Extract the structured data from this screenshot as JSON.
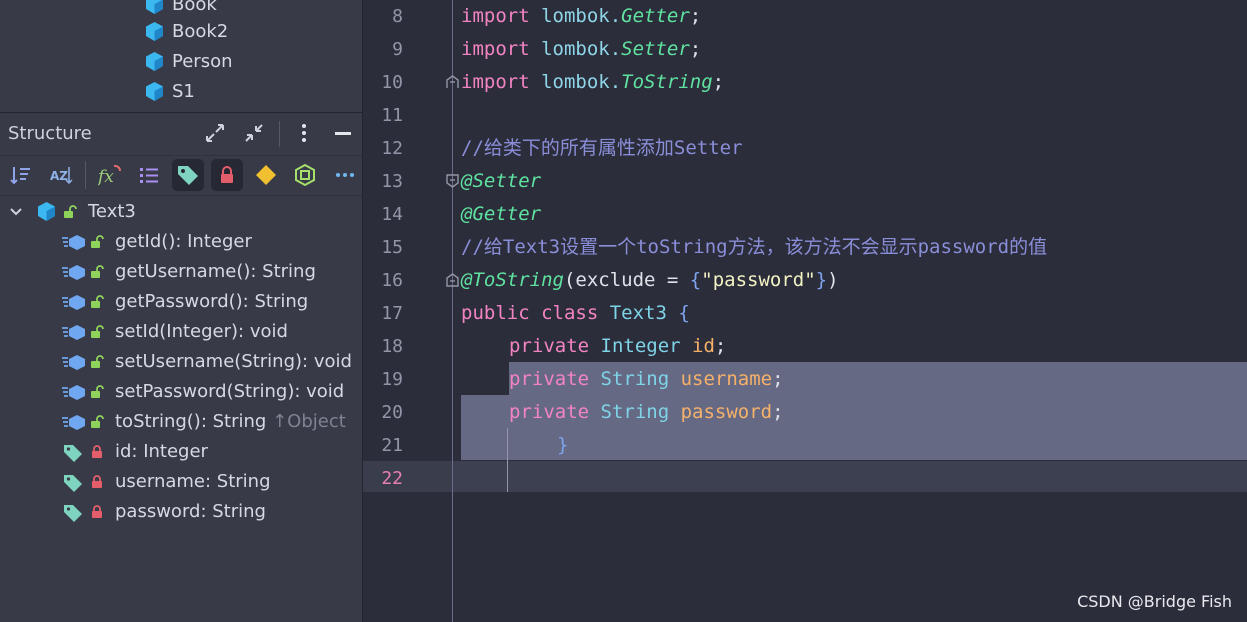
{
  "project": {
    "items": [
      {
        "label": "Book"
      },
      {
        "label": "Book2"
      },
      {
        "label": "Person"
      },
      {
        "label": "S1"
      }
    ]
  },
  "structure": {
    "title": "Structure",
    "root": "Text3",
    "members": [
      {
        "label": "getId(): Integer",
        "kind": "method",
        "access": "public"
      },
      {
        "label": "getUsername(): String",
        "kind": "method",
        "access": "public"
      },
      {
        "label": "getPassword(): String",
        "kind": "method",
        "access": "public"
      },
      {
        "label": "setId(Integer): void",
        "kind": "method",
        "access": "public"
      },
      {
        "label": "setUsername(String): void",
        "kind": "method",
        "access": "public"
      },
      {
        "label": "setPassword(String): void",
        "kind": "method",
        "access": "public"
      },
      {
        "label": "toString(): String",
        "suffix": "↑Object",
        "kind": "method",
        "access": "public"
      },
      {
        "label": "id: Integer",
        "kind": "field",
        "access": "private"
      },
      {
        "label": "username: String",
        "kind": "field",
        "access": "private"
      },
      {
        "label": "password: String",
        "kind": "field",
        "access": "private"
      }
    ]
  },
  "editor": {
    "line_numbers": [
      "8",
      "9",
      "10",
      "11",
      "12",
      "13",
      "14",
      "15",
      "16",
      "17",
      "18",
      "19",
      "20",
      "21",
      "22"
    ],
    "lines": {
      "l8": {
        "kw": "import",
        "pkg": " lombok.",
        "cls": "Getter",
        "end": ";"
      },
      "l9": {
        "kw": "import",
        "pkg": " lombok.",
        "cls": "Setter",
        "end": ";"
      },
      "l10": {
        "kw": "import",
        "pkg": " lombok.",
        "cls": "ToString",
        "end": ";"
      },
      "l12": {
        "comment": "//给类下的所有属性添加Setter"
      },
      "l13": {
        "ann": "@Setter"
      },
      "l14": {
        "ann": "@Getter"
      },
      "l15": {
        "comment": "//给Text3设置一个toString方法，该方法不会显示password的值"
      },
      "l16": {
        "ann": "@ToString",
        "p1": "(exclude = ",
        "b1": "{",
        "str": "\"password\"",
        "b2": "}",
        "p2": ")"
      },
      "l17": {
        "kw": "public class",
        "name": " Text3 ",
        "brace": "{"
      },
      "l18": {
        "kw": "private",
        "type": " Integer ",
        "field": "id",
        "end": ";"
      },
      "l19": {
        "kw": "private",
        "type": " String ",
        "field": "username",
        "end": ";"
      },
      "l20": {
        "kw": "private",
        "type": " String ",
        "field": "password",
        "end": ";"
      },
      "l21": {
        "brace": "}"
      }
    }
  },
  "colors": {
    "editor_bg": "#2b2d3a",
    "panel_bg": "#383a47",
    "selection": "#656983",
    "keyword": "#f384c3",
    "annotation": "#5fe2a0",
    "comment": "#8a8ed8",
    "field": "#f5b16a"
  },
  "watermark": "CSDN @Bridge Fish"
}
